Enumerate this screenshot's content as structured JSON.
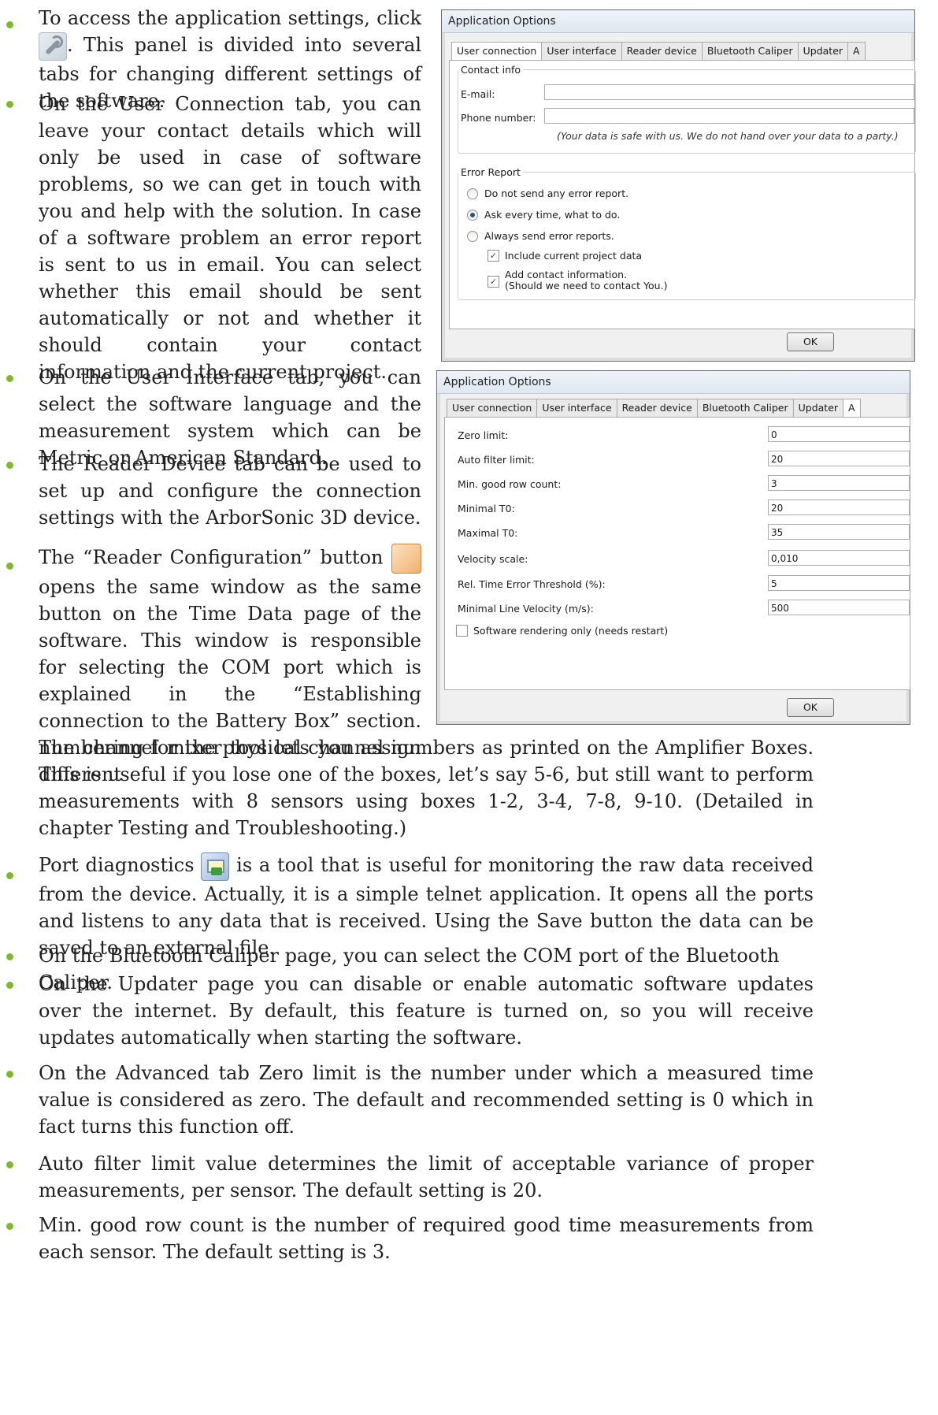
{
  "top_paragraphs": [
    {
      "pre": "To access the application settings, click",
      "post": ". This panel is divided into several tabs for changing different settings of the software."
    },
    {
      "text": "On the User Connection tab, you can leave your contact details which will only be used in case of software problems, so we can get in touch with you and help with the solution. In case of a software problem an error report is sent to us in email. You can select whether this email should be sent automatically or not and whether it should contain your contact information and the current project."
    },
    {
      "text": "On the User Interface tab, you can select the software language and the measurement system which can be Metric or American Standard."
    },
    {
      "text": "The Reader Device tab can be used to set up and configure the connection settings with the ArborSonic 3D device."
    },
    {
      "pre": "The “Reader Configuration” button",
      "post": "opens the same window as the same button on the Time Data page of the software. This window is responsible for selecting the COM port which is explained in the “Establishing connection to the Battery Box” section. The channel mixer tool lets you assign different"
    }
  ],
  "continuation": "numbering for the physical channel numbers as printed on the Amplifier Boxes. This is useful if you lose one of the boxes, let’s say 5-6, but still want to perform measurements with 8 sensors using boxes 1-2, 3-4, 7-8, 9-10. (Detailed in chapter Testing and Troubleshooting.)",
  "bottom_paragraphs": [
    {
      "pre": "Port diagnostics",
      "post": "is a tool that is useful for monitoring the raw data received from the device. Actually, it is a simple telnet application. It opens all the ports and listens to any data that is received. Using the Save button the data can be saved to an external file."
    },
    {
      "text": "On the Bluetooth Caliper page, you can select the COM port of the Bluetooth Caliper."
    },
    {
      "text": "On the Updater page you can disable or enable automatic software updates over the internet. By default, this feature is turned on, so you will receive updates automatically when starting the software."
    },
    {
      "text": "On the Advanced tab Zero limit is the number under which a measured time value is considered as zero. The default and recommended setting is 0 which in fact turns this function off."
    },
    {
      "text": "Auto filter limit value determines the limit of acceptable variance of proper measurements, per sensor. The default setting is 20."
    },
    {
      "text": "Min. good row count is the number of required good time measurements from each sensor. The default setting is 3."
    }
  ],
  "dialog1": {
    "title": "Application Options",
    "tabs": [
      "User connection",
      "User interface",
      "Reader device",
      "Bluetooth Caliper",
      "Updater",
      "A"
    ],
    "contact_legend": "Contact info",
    "email_label": "E-mail:",
    "phone_label": "Phone number:",
    "privacy_note": "(Your data is safe with us. We do not hand over your data to a party.)",
    "error_legend": "Error Report",
    "radio_options": [
      "Do not send any error report.",
      "Ask every time, what to do.",
      "Always send error reports."
    ],
    "check_include": "Include current project data",
    "check_contact_1": "Add contact information.",
    "check_contact_2": "(Should we need to contact You.)",
    "ok": "OK"
  },
  "dialog2": {
    "title": "Application Options",
    "tabs": [
      "User connection",
      "User interface",
      "Reader device",
      "Bluetooth Caliper",
      "Updater",
      "A"
    ],
    "fields": [
      {
        "label": "Zero limit:",
        "value": "0"
      },
      {
        "label": "Auto filter limit:",
        "value": "20"
      },
      {
        "label": "Min. good row count:",
        "value": "3"
      },
      {
        "label": "Minimal T0:",
        "value": "20"
      },
      {
        "label": "Maximal T0:",
        "value": "35"
      },
      {
        "label": "Velocity scale:",
        "value": "0,010"
      },
      {
        "label": "Rel. Time Error Threshold (%):",
        "value": "5"
      },
      {
        "label": "Minimal Line Velocity (m/s):",
        "value": "500"
      }
    ],
    "software_rendering": "Software rendering only (needs restart)",
    "ok": "OK"
  },
  "colors": {
    "bullet": "#7db82e"
  }
}
